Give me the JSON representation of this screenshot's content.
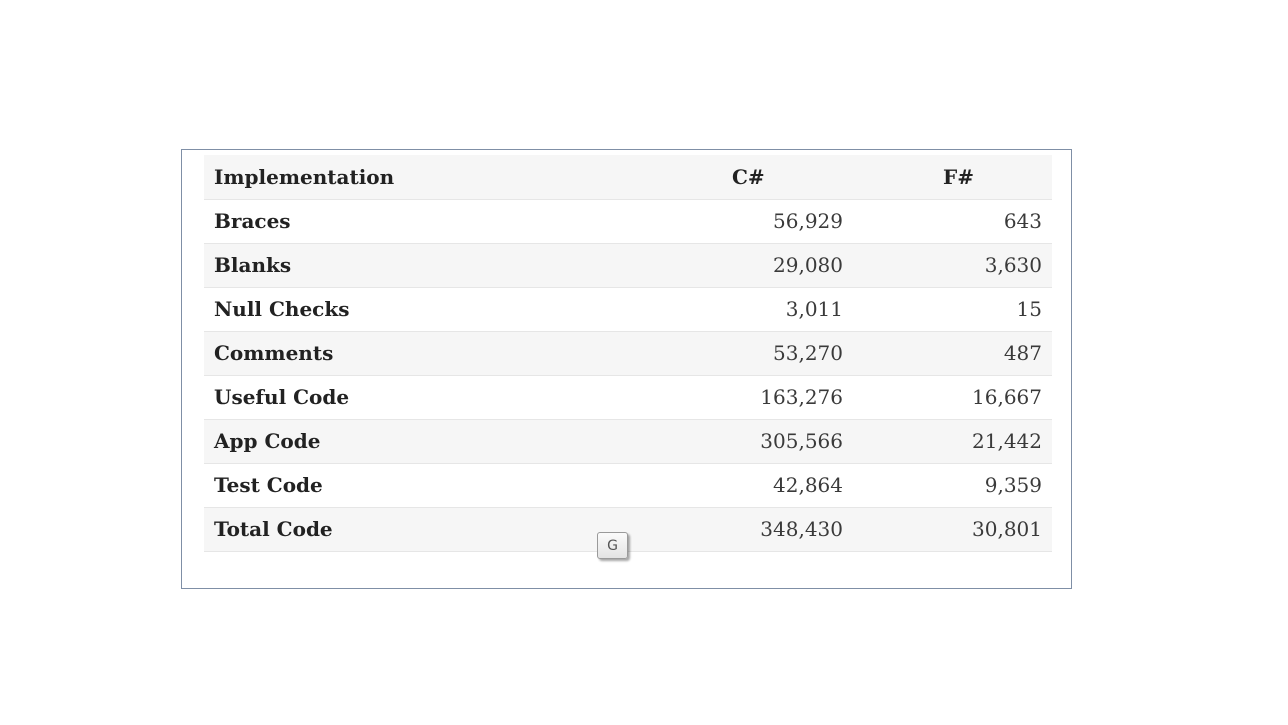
{
  "table": {
    "headers": [
      "Implementation",
      "C#",
      "F#"
    ],
    "rows": [
      {
        "label": "Braces",
        "csharp": "56,929",
        "fsharp": "643"
      },
      {
        "label": "Blanks",
        "csharp": "29,080",
        "fsharp": "3,630"
      },
      {
        "label": "Null Checks",
        "csharp": "3,011",
        "fsharp": "15"
      },
      {
        "label": "Comments",
        "csharp": "53,270",
        "fsharp": "487"
      },
      {
        "label": "Useful Code",
        "csharp": "163,276",
        "fsharp": "16,667"
      },
      {
        "label": "App Code",
        "csharp": "305,566",
        "fsharp": "21,442"
      },
      {
        "label": "Test Code",
        "csharp": "42,864",
        "fsharp": "9,359"
      },
      {
        "label": "Total Code",
        "csharp": "348,430",
        "fsharp": "30,801"
      }
    ]
  },
  "overlay": {
    "translate_badge_label": "G",
    "icon": "google-translate-icon"
  },
  "colors": {
    "frame_border": "#7f8fa6",
    "stripe": "#f6f6f6",
    "text": "#222222"
  }
}
